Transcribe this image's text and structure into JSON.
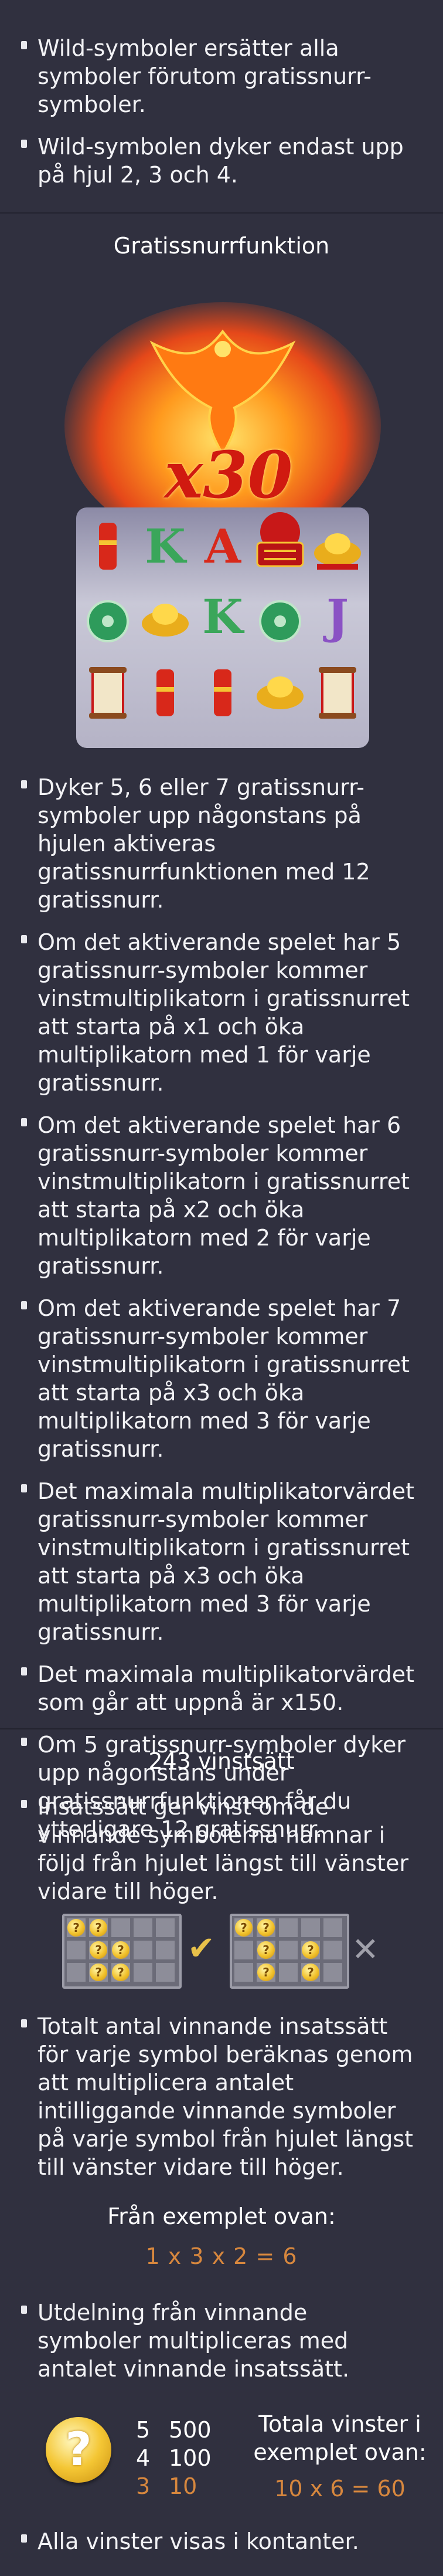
{
  "wild_bullets": [
    "Wild-symboler ersätter alla symboler förutom gratissnurr-symboler.",
    "Wild-symbolen dyker endast upp på hjul 2, 3 och 4."
  ],
  "free_spins": {
    "title": "Gratissnurrfunktion",
    "image_multiplier": "x30",
    "bullets": [
      "Dyker 5, 6 eller 7 gratissnurr-symboler upp någonstans på hjulen aktiveras gratissnurrfunktionen med 12 gratissnurr.",
      "Om det aktiverande spelet har 5 gratissnurr-symboler kommer vinstmultiplikatorn i gratissnurret att starta på x1 och öka multiplikatorn med 1 för varje gratissnurr.",
      "Om det aktiverande spelet har 6 gratissnurr-symboler kommer vinstmultiplikatorn i gratissnurret att starta på x2 och öka multiplikatorn med 2 för varje gratissnurr.",
      "Om det aktiverande spelet har 7 gratissnurr-symboler kommer vinstmultiplikatorn i gratissnurret att starta på x3 och öka multiplikatorn med 3 för varje gratissnurr.",
      "Det maximala multiplikatorvärdet gratissnurr-symboler kommer vinstmultiplikatorn i gratissnurret att starta på x3 och öka multiplikatorn med 3 för varje gratissnurr.",
      "Det maximala multiplikatorvärdet som går att uppnå är x150.",
      "Om 5 gratissnurr-symboler dyker upp någonstans under gratissnurrfunktionen får du ytterligare 12 gratissnurr."
    ]
  },
  "ways": {
    "title": "243 vinstsätt",
    "bullet1": "Insatssätt ger vinst om de vinnande symbolerna hamnar i följd från hjulet längst till vänster vidare till höger.",
    "bullet2": "Totalt antal vinnande insatssätt för varje symbol beräknas genom att multiplicera antalet intilliggande vinnande symboler på varje symbol från hjulet längst till vänster vidare till höger.",
    "example_label": "Från exemplet ovan:",
    "example_formula": "1 x 3 x 2 = 6",
    "bullet3": "Utdelning från vinnande symboler multipliceras med antalet vinnande insatssätt.",
    "paytable": [
      {
        "count": "5",
        "value": "500"
      },
      {
        "count": "4",
        "value": "100"
      },
      {
        "count": "3",
        "value": "10"
      }
    ],
    "totals_label": "Totala vinster i exemplet ovan:",
    "totals_formula": "10 x 6 = 60",
    "bullet4": "Alla vinster visas i kontanter.",
    "coin_symbol": "?",
    "valid_mark": "✔",
    "invalid_mark": "✕"
  },
  "colors": {
    "background": "#30303f",
    "accent": "#d7873e",
    "check": "#e8c14a",
    "cross": "#a0a0aa"
  }
}
